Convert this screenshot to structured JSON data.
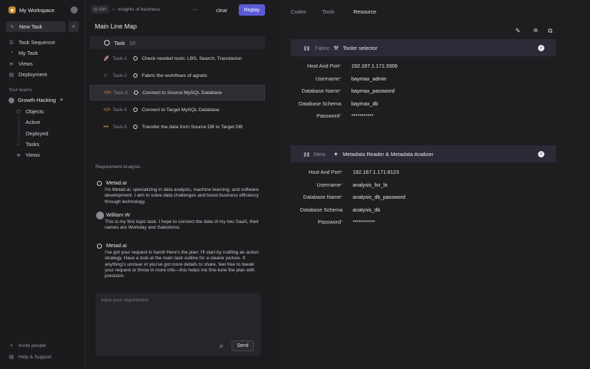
{
  "sidebar": {
    "workspace_name": "My Workspace",
    "new_task_label": "New Task",
    "nav": [
      {
        "label": "Task Sequence",
        "icon": "list-icon"
      },
      {
        "label": "My Task",
        "icon": "user-icon"
      },
      {
        "label": "Views",
        "icon": "layers-icon"
      },
      {
        "label": "Deployment",
        "icon": "book-icon"
      }
    ],
    "teams_heading": "Your teams",
    "team_name": "Growth Hacking",
    "team_items": [
      {
        "label": "Objects"
      },
      {
        "label": "Active"
      },
      {
        "label": "Deployed"
      },
      {
        "label": "Tasks"
      },
      {
        "label": "Views"
      }
    ],
    "invite_label": "Invite people",
    "help_label": "Help & Support"
  },
  "center": {
    "breadcrumb_root": "GH",
    "breadcrumb_page": "insights of business",
    "clear_label": "clear",
    "replay_label": "Replay",
    "title": "Main Line Map",
    "task_header": {
      "label": "Task",
      "count": "10"
    },
    "tasks": [
      {
        "id": "Task-1",
        "text": "Check needed tools: LBS, Search, Translasion",
        "icon": "rocket-icon",
        "icon_char": "🚀",
        "icon_color": "#e0a030"
      },
      {
        "id": "Task-2",
        "text": "Fabric the workflows of agnets",
        "icon": "star-icon",
        "icon_char": "☆",
        "icon_color": "#e0a030"
      },
      {
        "id": "Task-3",
        "text": "Connect to Source MySQL Database",
        "icon": "code-icon",
        "icon_char": "</>",
        "icon_color": "#e0a030"
      },
      {
        "id": "Task-4",
        "text": "Connect to Target MySQL Database",
        "icon": "code-icon",
        "icon_char": "</>",
        "icon_color": "#e0a030"
      },
      {
        "id": "Task-5",
        "text": "Transfer the data from Source DB to Target DB",
        "icon": "dots-icon",
        "icon_char": "•••",
        "icon_color": "#e0a030"
      }
    ],
    "req_title": "Requirement Analysis",
    "messages": [
      {
        "name": "Metad.ai",
        "text": "I'm Metad.ai, specializing in data analysis, machine learning, and software development. I aim to solve data challenges and boost business efficiency through technology."
      },
      {
        "name": "William W",
        "text": "This is my first topic task. I hope to connect the data of my two SaaS, their names are Workday and Salesforce."
      },
      {
        "name": "Metad.ai",
        "text": "I've got your request in hand! Here's the plan: I'll start by crafting an action strategy. Have a look at the main task outline for a clearer picture. If anything's unclear or you've got more details to share, feel free to tweak your request or throw in more info—this helps me fine-tune the plan with precision."
      }
    ],
    "input_placeholder": "Input your requirement",
    "send_label": "Send"
  },
  "right": {
    "tabs": [
      {
        "label": "Codes"
      },
      {
        "label": "Tools"
      },
      {
        "label": "Resource"
      }
    ],
    "active_tab": "Resource",
    "cards": [
      {
        "type": "Fabric",
        "name": "Tooler selector",
        "icon": "tool-icon",
        "fields": [
          {
            "label": "Host And Port",
            "required": true,
            "value": "192.167.1.171:3306"
          },
          {
            "label": "Username",
            "required": true,
            "value": "baymax_admin"
          },
          {
            "label": "Database Name",
            "required": true,
            "value": "baymax_password"
          },
          {
            "label": "Database Schema",
            "required": false,
            "value": "baymax_db"
          },
          {
            "label": "Password",
            "required": true,
            "value": "***********"
          }
        ]
      },
      {
        "type": "Meta",
        "name": "Metadata Reader & Metadata Analizer",
        "icon": "puzzle-icon",
        "fields": [
          {
            "label": "Host And Port",
            "required": true,
            "value": "192.167.1.171:8123"
          },
          {
            "label": "Username",
            "required": true,
            "value": "analysis_for_bi"
          },
          {
            "label": "Database Name",
            "required": true,
            "value": "analysis_db_password"
          },
          {
            "label": "Database Schema",
            "required": false,
            "value": "analysis_db"
          },
          {
            "label": "Password",
            "required": true,
            "value": "***********"
          }
        ]
      }
    ]
  },
  "colors": {
    "accent": "#5b5bd6",
    "required": "#e05555",
    "task_icon": "#e0a030"
  }
}
